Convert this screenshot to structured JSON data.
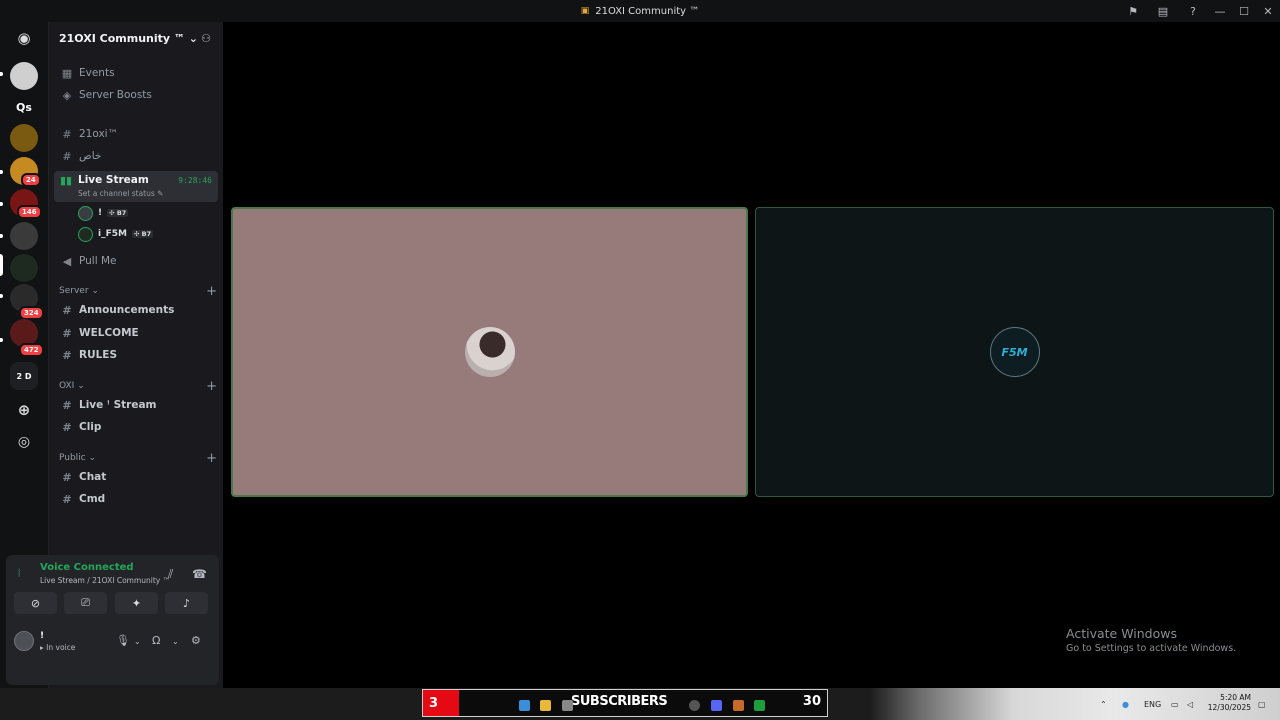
{
  "window": {
    "title": "21OXI Community ™"
  },
  "rail": {
    "servers": [
      {
        "label": ""
      },
      {
        "label": "Qs"
      },
      {
        "label": ""
      },
      {
        "label": "",
        "badge": "24"
      },
      {
        "label": "",
        "badge": "146"
      },
      {
        "label": ""
      },
      {
        "label": ""
      },
      {
        "label": "",
        "badge": "324"
      },
      {
        "label": "",
        "badge": "472"
      },
      {
        "label": "2 D"
      }
    ]
  },
  "server": {
    "name": "21OXI Community ™",
    "top_items": [
      {
        "label": "Events"
      },
      {
        "label": "Server Boosts"
      }
    ],
    "channels_top": [
      {
        "label": "21oxi™"
      },
      {
        "label": "خاص"
      }
    ],
    "live": {
      "name": "Live Stream",
      "status": "Set a channel status",
      "timer": "9:28:46",
      "users": [
        {
          "name": "!",
          "tag": "B7"
        },
        {
          "name": "i_F5M",
          "tag": "B7"
        }
      ]
    },
    "pull_me": "Pull Me",
    "categories": [
      {
        "name": "Server",
        "channels": [
          "Announcements",
          "WELCOME",
          "RULES"
        ]
      },
      {
        "name": "OXI",
        "channels": [
          "Live ꜝ Stream",
          "Clip"
        ]
      },
      {
        "name": "Public",
        "channels": [
          "Chat",
          "Cmd"
        ]
      }
    ]
  },
  "voice": {
    "title": "Voice Connected",
    "subtitle": "Live Stream / 21OXI Community ™"
  },
  "user": {
    "name": "!",
    "status": "In voice"
  },
  "stage": {
    "tile_b_label": "F5M"
  },
  "activation": {
    "heading": "Activate Windows",
    "sub": "Go to Settings to activate Windows."
  },
  "taskbar": {
    "widget_left": "3",
    "widget_label": "SUBSCRIBERS",
    "widget_right": "30",
    "lang": "ENG",
    "time": "5:20 AM",
    "date": "12/30/2025"
  }
}
